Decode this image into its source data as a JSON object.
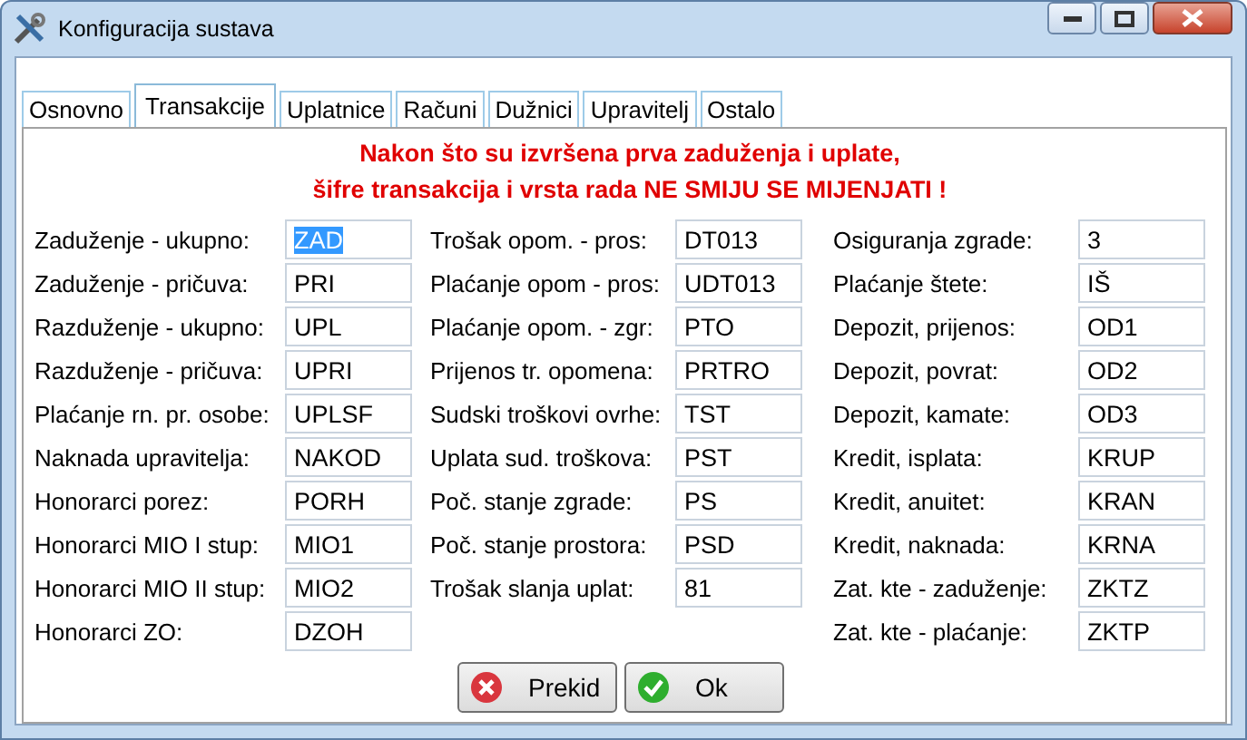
{
  "window": {
    "title": "Konfiguracija sustava"
  },
  "tabs": [
    {
      "label": "Osnovno",
      "selected": false
    },
    {
      "label": "Transakcije",
      "selected": true
    },
    {
      "label": "Uplatnice",
      "selected": false
    },
    {
      "label": "Računi",
      "selected": false
    },
    {
      "label": "Dužnici",
      "selected": false
    },
    {
      "label": "Upravitelj",
      "selected": false
    },
    {
      "label": "Ostalo",
      "selected": false
    }
  ],
  "warning": [
    "Nakon što su izvršena prva zaduženja i uplate,",
    "šifre transakcija i vrsta rada NE SMIJU SE MIJENJATI !"
  ],
  "columns": [
    [
      {
        "label": "Zaduženje - ukupno:",
        "value": "ZAD",
        "selected": true
      },
      {
        "label": "Zaduženje - pričuva:",
        "value": "PRI",
        "selected": false
      },
      {
        "label": "Razduženje - ukupno:",
        "value": "UPL",
        "selected": false
      },
      {
        "label": "Razduženje - pričuva:",
        "value": "UPRI",
        "selected": false
      },
      {
        "label": "Plaćanje rn. pr. osobe:",
        "value": "UPLSF",
        "selected": false
      },
      {
        "label": "Naknada upravitelja:",
        "value": "NAKOD",
        "selected": false
      },
      {
        "label": "Honorarci porez:",
        "value": "PORH",
        "selected": false
      },
      {
        "label": "Honorarci MIO I stup:",
        "value": "MIO1",
        "selected": false
      },
      {
        "label": "Honorarci MIO II stup:",
        "value": "MIO2",
        "selected": false
      },
      {
        "label": "Honorarci ZO:",
        "value": "DZOH",
        "selected": false
      }
    ],
    [
      {
        "label": "Trošak opom. - pros:",
        "value": "DT013",
        "selected": false
      },
      {
        "label": "Plaćanje opom - pros:",
        "value": "UDT013",
        "selected": false
      },
      {
        "label": "Plaćanje opom. - zgr:",
        "value": "PTO",
        "selected": false
      },
      {
        "label": "Prijenos tr. opomena:",
        "value": "PRTRO",
        "selected": false
      },
      {
        "label": "Sudski troškovi ovrhe:",
        "value": "TST",
        "selected": false
      },
      {
        "label": "Uplata sud. troškova:",
        "value": "PST",
        "selected": false
      },
      {
        "label": "Poč. stanje zgrade:",
        "value": "PS",
        "selected": false
      },
      {
        "label": "Poč. stanje prostora:",
        "value": "PSD",
        "selected": false
      },
      {
        "label": "Trošak slanja uplat:",
        "value": "81",
        "selected": false
      }
    ],
    [
      {
        "label": "Osiguranja zgrade:",
        "value": "3",
        "selected": false
      },
      {
        "label": "Plaćanje štete:",
        "value": "IŠ",
        "selected": false
      },
      {
        "label": "Depozit, prijenos:",
        "value": "OD1",
        "selected": false
      },
      {
        "label": "Depozit, povrat:",
        "value": "OD2",
        "selected": false
      },
      {
        "label": "Depozit, kamate:",
        "value": "OD3",
        "selected": false
      },
      {
        "label": "Kredit, isplata:",
        "value": "KRUP",
        "selected": false
      },
      {
        "label": "Kredit, anuitet:",
        "value": "KRAN",
        "selected": false
      },
      {
        "label": "Kredit, naknada:",
        "value": "KRNA",
        "selected": false
      },
      {
        "label": "Zat. kte - zaduženje:",
        "value": "ZKTZ",
        "selected": false
      },
      {
        "label": "Zat. kte - plaćanje:",
        "value": "ZKTP",
        "selected": false
      }
    ]
  ],
  "buttons": [
    {
      "label": "Prekid",
      "kind": "cancel"
    },
    {
      "label": "Ok",
      "kind": "ok"
    }
  ]
}
